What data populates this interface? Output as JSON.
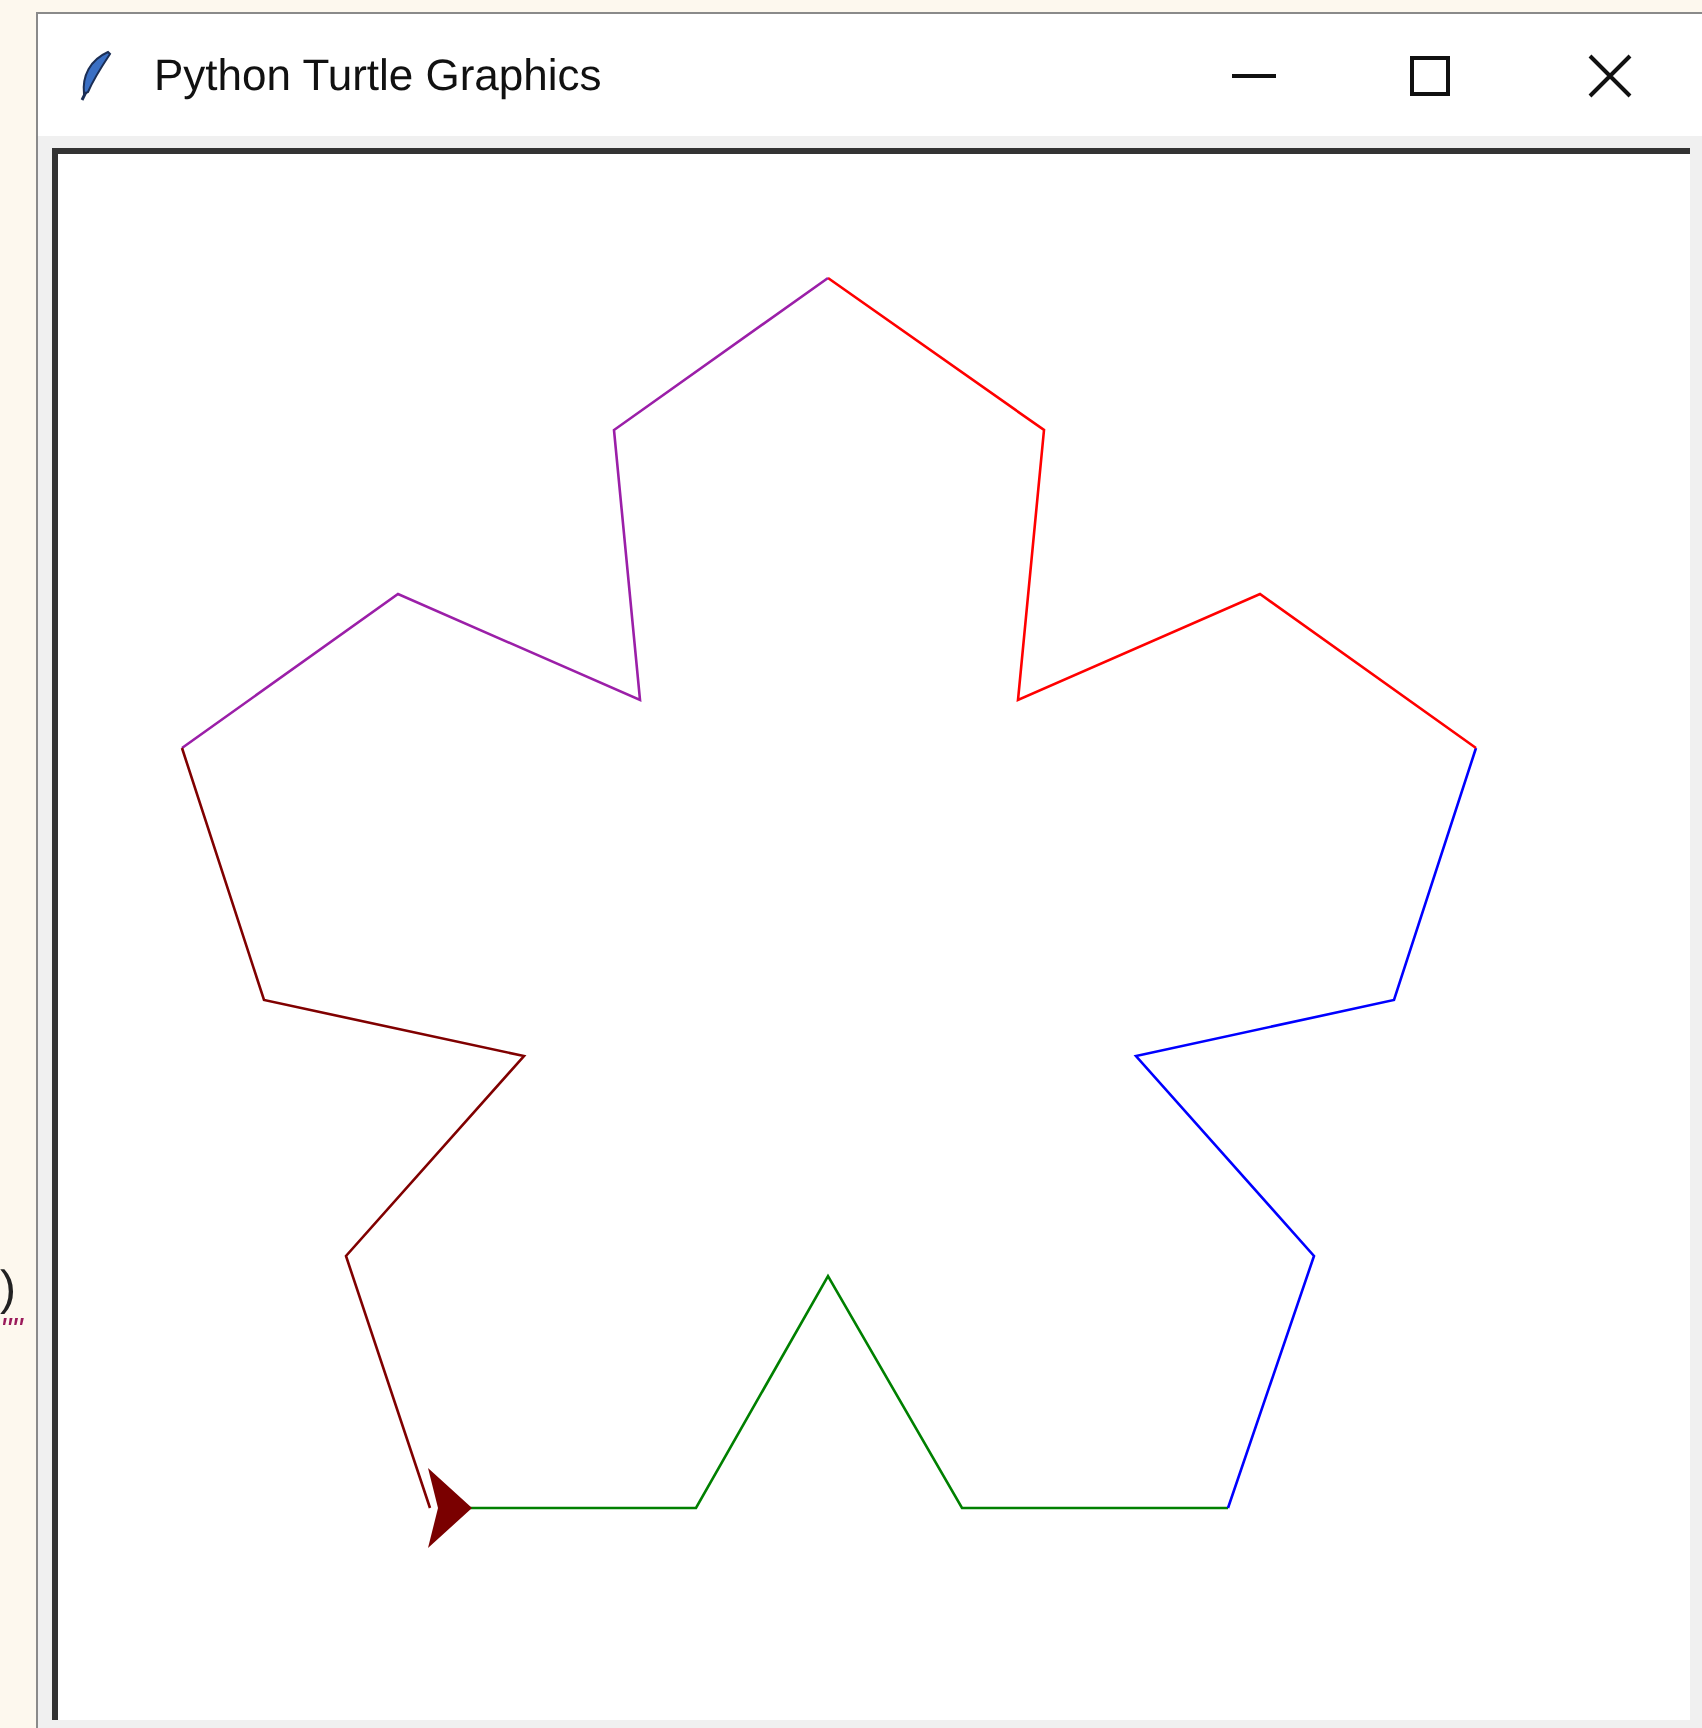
{
  "background_text": [
    ")",
    "\"\""
  ],
  "window": {
    "title": "Python Turtle Graphics"
  }
}
